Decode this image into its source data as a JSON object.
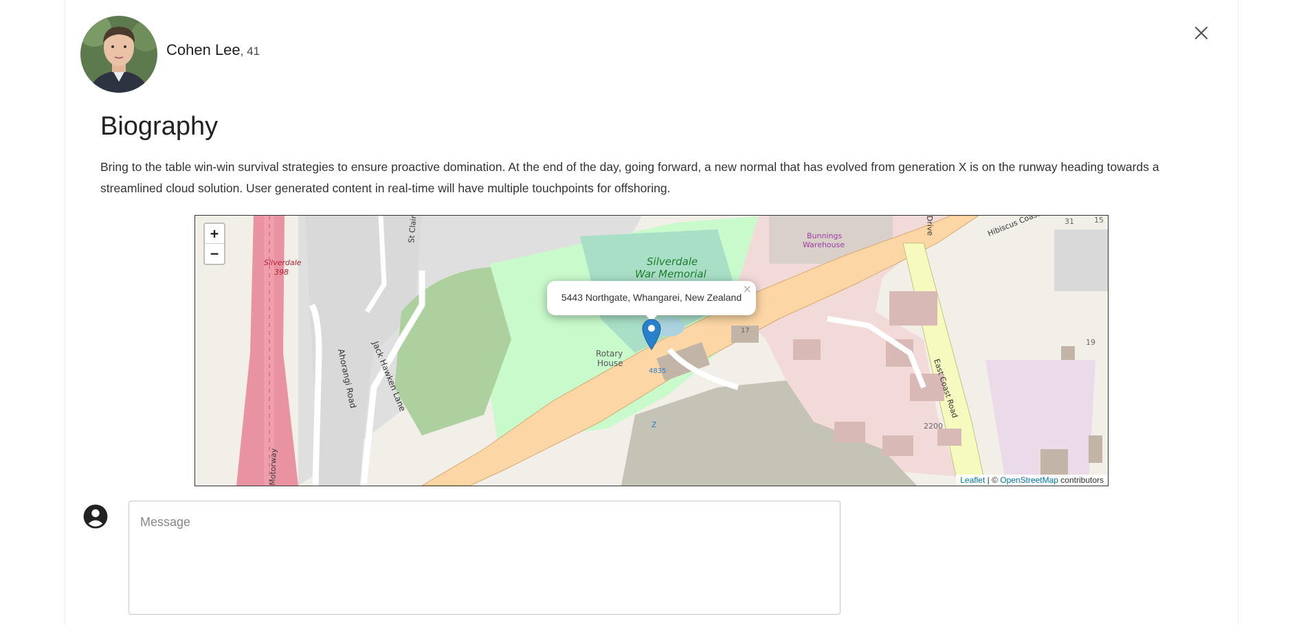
{
  "profile": {
    "name": "Cohen Lee",
    "age_suffix": ", 41"
  },
  "biography": {
    "title": "Biography",
    "text": "Bring to the table win-win survival strategies to ensure proactive domination. At the end of the day, going forward, a new normal that has evolved from generation X is on the runway heading towards a streamlined cloud solution. User generated content in real-time will have multiple touchpoints for offshoring."
  },
  "map": {
    "zoom_in": "+",
    "zoom_out": "−",
    "popup_text": "5443 Northgate, Whangarei, New Zealand",
    "popup_close": "×",
    "attribution": {
      "leaflet": "Leaflet",
      "separator": " | © ",
      "osm": "OpenStreetMap",
      "suffix": " contributors"
    },
    "labels": {
      "silverdale": "Silverdale",
      "silverdale_398": "398",
      "war_memorial_1": "Silverdale",
      "war_memorial_2": "War Memorial",
      "bunnings_1": "Bunnings",
      "bunnings_2": "Warehouse",
      "hibiscus": "Hibiscus Coast",
      "east_coast": "East Coast Road",
      "rotary_1": "Rotary",
      "rotary_2": "House",
      "ahorangi": "Ahorangi Road",
      "jack_hawken": "Jack Hawken Lane",
      "st_clair": "St Clair",
      "motorway": "Motorway",
      "drive": "Drive",
      "num_4835": "4835",
      "num_2200": "2200",
      "num_17": "17",
      "num_19": "19",
      "num_31": "31",
      "num_15": "15",
      "z": "Z"
    }
  },
  "message": {
    "placeholder": "Message"
  },
  "colors": {
    "marker": "#2a81cb",
    "motorway": "#e892a2",
    "trunk": "#fcd6a4",
    "park": "#c8facc",
    "wood": "#add19e",
    "commercial": "#f2dad9"
  }
}
